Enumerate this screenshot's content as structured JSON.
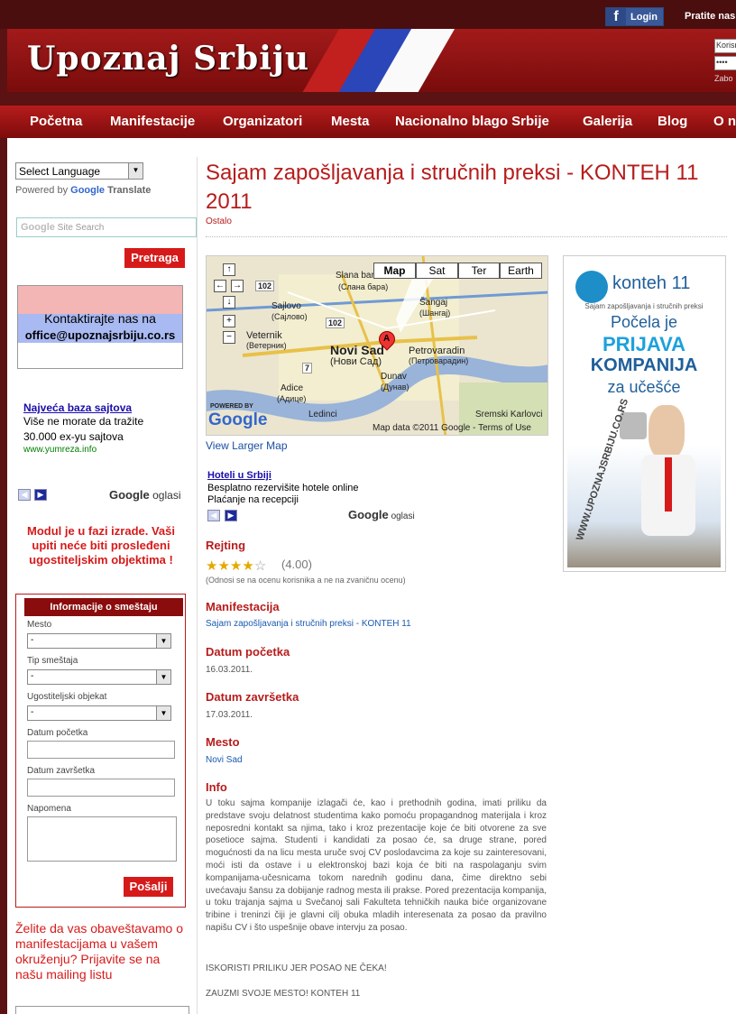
{
  "topbar": {
    "login_label": "Login",
    "follow_label": "Pratite nas"
  },
  "header": {
    "site_title": "Upoznaj Srbiju",
    "login_user_placeholder": "Korisn",
    "forgot_label": "Zabo"
  },
  "nav": {
    "items": [
      "Početna",
      "Manifestacije",
      "Organizatori",
      "Mesta",
      "Nacionalno blago Srbije",
      "Galerija",
      "Blog",
      "O n"
    ]
  },
  "sidebar": {
    "language_select": "Select Language",
    "powered_by": "Powered by",
    "google_label": "Google",
    "translate_label": "Translate",
    "site_search_placeholder": "Site Search",
    "search_button": "Pretraga",
    "contact_line1": "Kontaktirajte nas na",
    "contact_line2": "office@upoznajsrbiju.co.rs",
    "ad": {
      "title": "Najveća baza sajtova",
      "line1": "Više ne morate da tražite",
      "line2": "30.000 ex-yu sajtova",
      "url": "www.yumreza.info"
    },
    "google_ads_label": "Google",
    "oglasi_label": "oglasi",
    "module_warning": "Modul je u fazi izrade. Vaši upiti neće biti prosleđeni ugostiteljskim objektima !",
    "info_box": {
      "heading": "Informacije o smeštaju",
      "mesto_label": "Mesto",
      "mesto_value": "-",
      "tip_label": "Tip smeštaja",
      "tip_value": "-",
      "objekat_label": "Ugostiteljski objekat",
      "objekat_value": "-",
      "datum_pocetka_label": "Datum početka",
      "datum_zavrsetka_label": "Datum završetka",
      "napomena_label": "Napomena",
      "send_button": "Pošalji"
    },
    "mailing_text": "Želite da vas obaveštavamo o manifestacijama u vašem okruženju? Prijavite se na našu mailing listu"
  },
  "main": {
    "title": "Sajam zapošljavanja i stručnih preksi - KONTEH 11 2011",
    "category": "Ostalo",
    "map": {
      "types": [
        "Map",
        "Sat",
        "Ter",
        "Earth"
      ],
      "labels": {
        "city": "Novi Sad",
        "city_cyr": "(Нови Сад)",
        "petrovaradin": "Petrovaradin",
        "petrovaradin_cyr": "(Петроварадин)",
        "veternik": "Veternik",
        "veternik_cyr": "(Ветерник)",
        "sajlovo": "Sajlovo",
        "sajlovo_cyr": "(Сајлово)",
        "slana_bara": "Slana bara",
        "slana_bara_cyr": "(Слана бара)",
        "sangaj": "Šangaj",
        "sangaj_cyr": "(Шангај)",
        "dunav": "Dunav",
        "dunav_cyr": "(Дунав)",
        "adice": "Adice",
        "adice_cyr": "(Адице)",
        "ledinci": "Ledinci",
        "sremski_karlovci": "Sremski Karlovci",
        "road_102a": "102",
        "road_102b": "102",
        "road_7": "7",
        "marker": "A",
        "powered_by": "POWERED BY",
        "google": "Google",
        "map_data": "Map data ©2011 Google - Terms of Use"
      },
      "larger_map": "View Larger Map"
    },
    "hotel_ad": {
      "title": "Hoteli u Srbiji",
      "line1": "Besplatno rezervišite hotele online",
      "line2": "Plaćanje na recepciji"
    },
    "google_ads_label": "Google",
    "oglasi_label": "oglasi",
    "rating": {
      "heading": "Rejting",
      "value": "(4.00)",
      "stars": 4,
      "note": "(Odnosi se na ocenu korisnika a ne na zvaničnu ocenu)"
    },
    "manifestacija": {
      "heading": "Manifestacija",
      "value": "Sajam zapošljavanja i stručnih preksi - KONTEH 11"
    },
    "datum_pocetka": {
      "heading": "Datum početka",
      "value": "16.03.2011."
    },
    "datum_zavrsetka": {
      "heading": "Datum završetka",
      "value": "17.03.2011."
    },
    "mesto": {
      "heading": "Mesto",
      "value": "Novi Sad"
    },
    "info": {
      "heading": "Info",
      "text": "U toku sajma kompanije izlagači će, kao i prethodnih godina, imati priliku da predstave svoju delatnost studentima kako pomoću propagandnog materijala i kroz neposredni kontakt sa njima, tako i kroz prezentacije koje će biti otvorene za sve posetioce sajma. Studenti i kandidati za posao će, sa druge strane, pored mogućnosti da na licu mesta uruče svoj CV poslodavcima za koje su zainteresovani, moći isti da ostave i u elektronskoj bazi koja će biti na raspolaganju svim kompanijama-učesnicama tokom narednih godinu dana, čime direktno sebi uvećavaju šansu za dobijanje radnog mesta ili prakse. Pored prezentacija kompanija, u toku trajanja sajma u Svečanoj sali Fakulteta tehničkih nauka biće organizovane tribine i treninzi čiji je glavni cilj obuka mladih interesenata za posao da pravilno napišu CV i što uspešnije obave intervju za posao.",
      "extra1": "ISKORISTI PRILIKU JER POSAO NE ČEKA!",
      "extra2": "ZAUZMI SVOJE MESTO! KONTEH 11"
    }
  },
  "banner": {
    "logo_text": "konteh 11",
    "subtitle": "Sajam zapošljavanja i stručnih preksi",
    "line1": "Počela je",
    "line2": "PRIJAVA",
    "line3": "KOMPANIJA",
    "line4": "za učešće",
    "vertical_url": "WWW.UPOZNAJSRBIJU.CO.RS"
  },
  "colors": {
    "brand_red": "#b71c1c",
    "nav_red": "#9a1414",
    "facebook_blue": "#3b5998",
    "link_blue": "#1a0dab"
  }
}
